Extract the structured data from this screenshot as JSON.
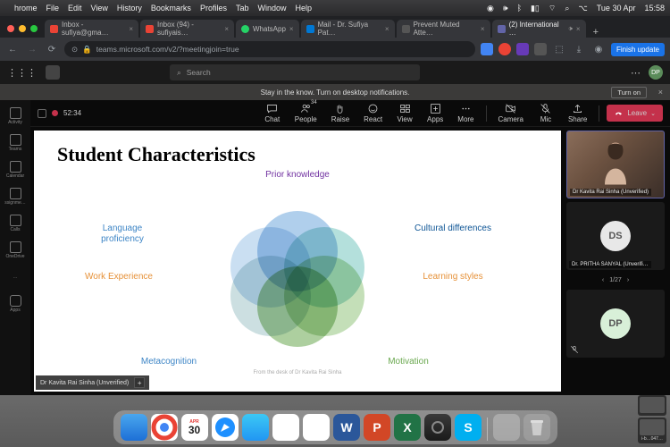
{
  "mac": {
    "app": "hrome",
    "menu": [
      "File",
      "Edit",
      "View",
      "History",
      "Bookmarks",
      "Profiles",
      "Tab",
      "Window",
      "Help"
    ],
    "date": "Tue 30 Apr",
    "time": "15:58"
  },
  "browser": {
    "tabs": [
      {
        "label": "Inbox - sufiya@gma…",
        "icon": "#ea4335"
      },
      {
        "label": "Inbox (94) - sufiyais…",
        "icon": "#ea4335"
      },
      {
        "label": "WhatsApp",
        "icon": "#25d366"
      },
      {
        "label": "Mail - Dr. Sufiya Pat…",
        "icon": "#0078d4"
      },
      {
        "label": "Prevent Muted Atte…",
        "icon": "#444"
      },
      {
        "label": "(2) International …",
        "icon": "#6264a7",
        "active": true
      }
    ],
    "url": "teams.microsoft.com/v2/?meetingjoin=true",
    "finish_update": "Finish update"
  },
  "teams": {
    "search_placeholder": "Search",
    "avatar": "DP",
    "rail": [
      {
        "label": "Activity"
      },
      {
        "label": "Teams"
      },
      {
        "label": "Calendar"
      },
      {
        "label": "ssignme…"
      },
      {
        "label": "Calls"
      },
      {
        "label": "OneDrive"
      },
      {
        "label": "…"
      },
      {
        "label": "Apps"
      }
    ],
    "notif": "Stay in the know. Turn on desktop notifications.",
    "turn_on": "Turn on"
  },
  "meeting": {
    "timer": "52:34",
    "toolbar": [
      {
        "label": "Chat"
      },
      {
        "label": "People",
        "badge": "34"
      },
      {
        "label": "Raise"
      },
      {
        "label": "React"
      },
      {
        "label": "View"
      },
      {
        "label": "Apps"
      },
      {
        "label": "More"
      }
    ],
    "devices": [
      {
        "label": "Camera"
      },
      {
        "label": "Mic"
      },
      {
        "label": "Share"
      }
    ],
    "leave": "Leave",
    "slide": {
      "title": "Student Characteristics",
      "labels": {
        "prior": "Prior knowledge",
        "cultural": "Cultural differences",
        "learning": "Learning styles",
        "motivation": "Motivation",
        "metacog": "Metacognition",
        "work": "Work Experience",
        "language": "Language proficiency"
      },
      "credit": "From the desk of Dr Kavita Rai Sinha"
    },
    "presenter": "Dr Kavita Rai Sinha (Unverified)",
    "participants": [
      {
        "name": "Dr Kavita Rai Sinha (Unverified)",
        "type": "cam"
      },
      {
        "name": "Dr. PRITHA SANYAL (Unverifi…",
        "type": "init",
        "initials": "DS"
      },
      {
        "name": "",
        "type": "init",
        "initials": "DP"
      }
    ],
    "page_indicator": "1/27"
  },
  "dock": {
    "cal_month": "APR",
    "cal_day": "30",
    "thumb_label": "i-b…047…"
  }
}
